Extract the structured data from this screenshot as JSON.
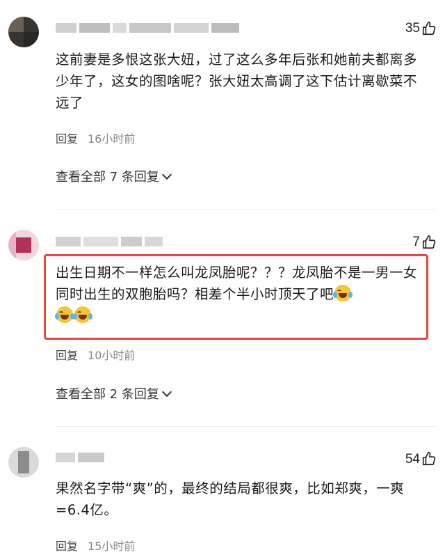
{
  "comments": [
    {
      "likes": "35",
      "text": "这前妻是多恨这张大妞，过了这么多年后张和她前夫都离多少年了，这女的图啥呢？张大妞太高调了这下估计离歇菜不远了",
      "reply_label": "回复",
      "time": "16小时前",
      "view_all": "查看全部 7 条回复"
    },
    {
      "likes": "7",
      "text": "出生日期不一样怎么叫龙凤胎呢？？？龙凤胎不是一男一女同时出生的双胞胎吗？相差个半小时顶天了吧",
      "reply_label": "回复",
      "time": "10小时前",
      "view_all": "查看全部 2 条回复"
    },
    {
      "likes": "54",
      "text": "果然名字带“爽”的，最终的结局都很爽，比如郑爽，一爽=6.4亿。",
      "reply_label": "回复",
      "time": "15小时前"
    }
  ],
  "colors": {
    "highlight": "#e8453c",
    "emoji": "#f7c531"
  },
  "icons": {
    "like": "thumbs-up-icon",
    "expand": "chevron-down-icon",
    "emoji": "laugh-cry-emoji-icon"
  }
}
